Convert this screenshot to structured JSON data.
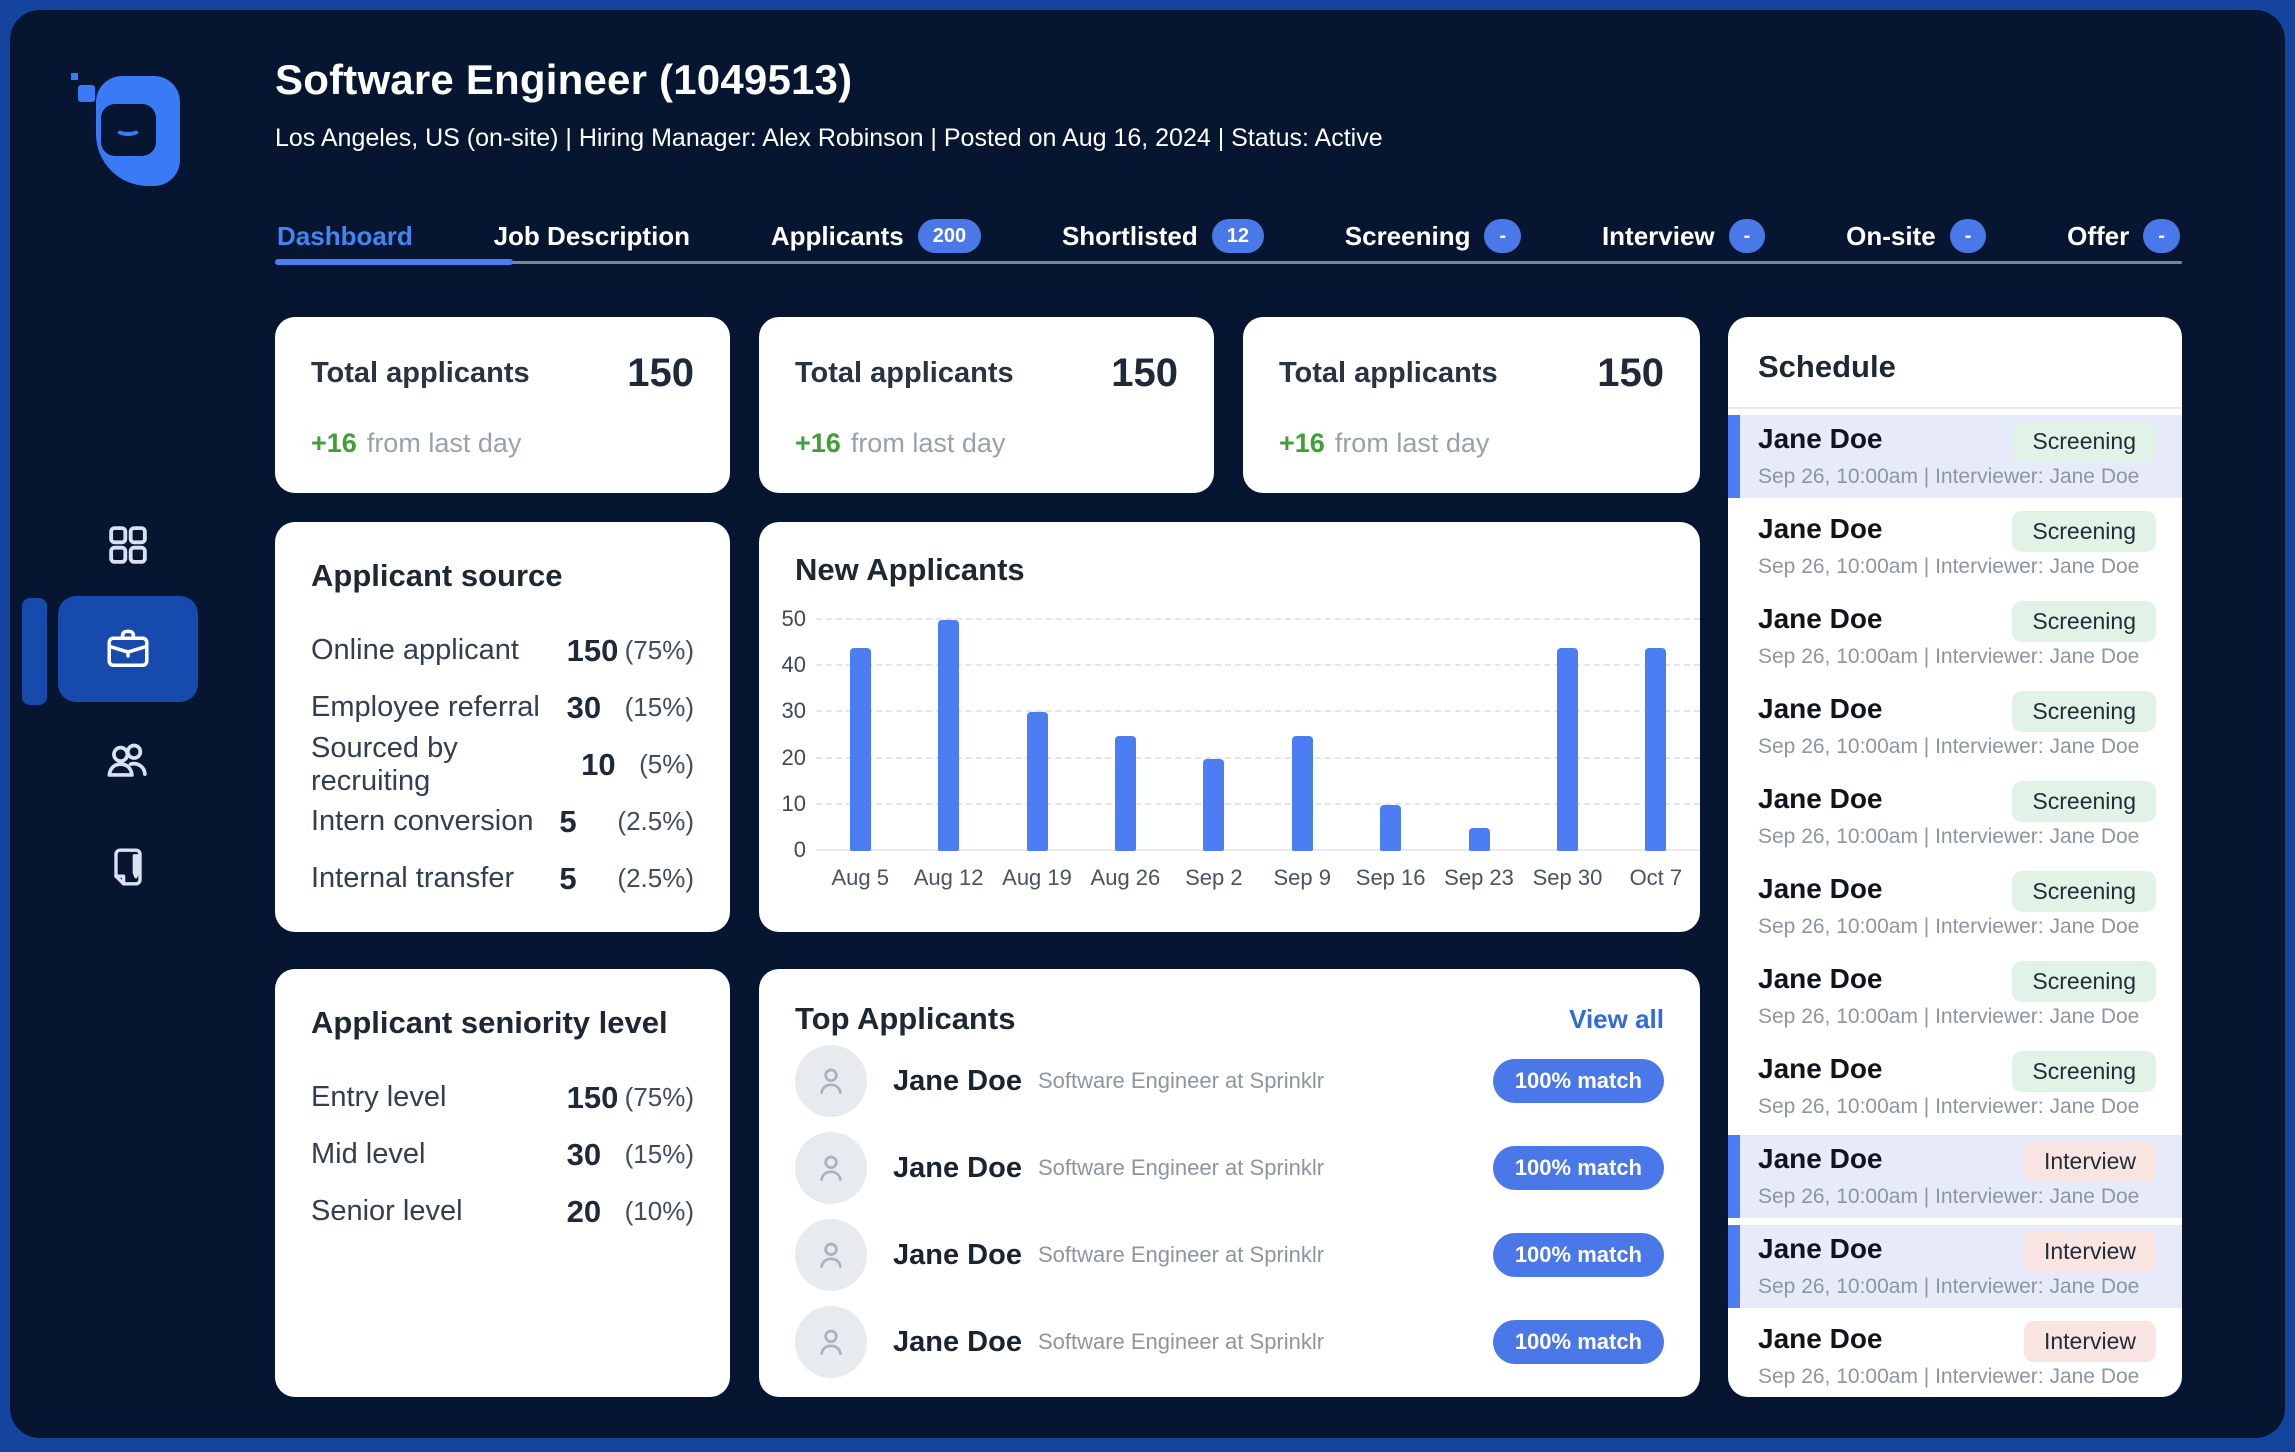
{
  "header": {
    "title": "Software Engineer (1049513)",
    "subtitle": "Los Angeles, US (on-site) | Hiring Manager: Alex Robinson | Posted on Aug 16, 2024 | Status: Active"
  },
  "tabs": [
    {
      "label": "Dashboard",
      "active": true
    },
    {
      "label": "Job Description"
    },
    {
      "label": "Applicants",
      "badge": "200"
    },
    {
      "label": "Shortlisted",
      "badge": "12"
    },
    {
      "label": "Screening",
      "badge": "-"
    },
    {
      "label": "Interview",
      "badge": "-"
    },
    {
      "label": "On-site",
      "badge": "-"
    },
    {
      "label": "Offer",
      "badge": "-"
    }
  ],
  "stats": [
    {
      "title": "Total applicants",
      "value": "150",
      "delta": "+16",
      "caption": "from last day"
    },
    {
      "title": "Total applicants",
      "value": "150",
      "delta": "+16",
      "caption": "from last day"
    },
    {
      "title": "Total applicants",
      "value": "150",
      "delta": "+16",
      "caption": "from last day"
    }
  ],
  "source": {
    "title": "Applicant source",
    "rows": [
      {
        "label": "Online applicant",
        "value": "150",
        "pct": "(75%)"
      },
      {
        "label": "Employee referral",
        "value": "30",
        "pct": "(15%)"
      },
      {
        "label": "Sourced by recruiting",
        "value": "10",
        "pct": "(5%)"
      },
      {
        "label": "Intern conversion",
        "value": "5",
        "pct": "(2.5%)"
      },
      {
        "label": "Internal transfer",
        "value": "5",
        "pct": "(2.5%)"
      }
    ]
  },
  "chart_data": {
    "type": "bar",
    "title": "New Applicants",
    "categories": [
      "Aug 5",
      "Aug 12",
      "Aug 19",
      "Aug 26",
      "Sep 2",
      "Sep 9",
      "Sep 16",
      "Sep 23",
      "Sep 30",
      "Oct 7"
    ],
    "values": [
      44,
      50,
      30,
      25,
      20,
      25,
      10,
      5,
      44,
      44
    ],
    "xlabel": "",
    "ylabel": "",
    "ylim": [
      0,
      50
    ],
    "yticks": [
      0,
      10,
      20,
      30,
      40,
      50
    ],
    "grid": "dashed-horizontal",
    "legend": "none",
    "bar_color": "#4d7df2"
  },
  "seniority": {
    "title": "Applicant seniority level",
    "rows": [
      {
        "label": "Entry level",
        "value": "150",
        "pct": "(75%)"
      },
      {
        "label": "Mid level",
        "value": "30",
        "pct": "(15%)"
      },
      {
        "label": "Senior level",
        "value": "20",
        "pct": "(10%)"
      }
    ]
  },
  "top_applicants": {
    "title": "Top Applicants",
    "view_all": "View all",
    "rows": [
      {
        "name": "Jane Doe",
        "role": "Software Engineer at Sprinklr",
        "match": "100% match"
      },
      {
        "name": "Jane Doe",
        "role": "Software Engineer at Sprinklr",
        "match": "100% match"
      },
      {
        "name": "Jane Doe",
        "role": "Software Engineer at Sprinklr",
        "match": "100% match"
      },
      {
        "name": "Jane Doe",
        "role": "Software Engineer at Sprinklr",
        "match": "100% match"
      }
    ]
  },
  "schedule": {
    "title": "Schedule",
    "items": [
      {
        "name": "Jane Doe",
        "stage": "Screening",
        "type": "screening",
        "detail": "Sep 26, 10:00am | Interviewer: Jane Doe",
        "highlighted": true
      },
      {
        "name": "Jane Doe",
        "stage": "Screening",
        "type": "screening",
        "detail": "Sep 26, 10:00am | Interviewer: Jane Doe",
        "highlighted": false
      },
      {
        "name": "Jane Doe",
        "stage": "Screening",
        "type": "screening",
        "detail": "Sep 26, 10:00am | Interviewer: Jane Doe",
        "highlighted": false
      },
      {
        "name": "Jane Doe",
        "stage": "Screening",
        "type": "screening",
        "detail": "Sep 26, 10:00am | Interviewer: Jane Doe",
        "highlighted": false
      },
      {
        "name": "Jane Doe",
        "stage": "Screening",
        "type": "screening",
        "detail": "Sep 26, 10:00am | Interviewer: Jane Doe",
        "highlighted": false
      },
      {
        "name": "Jane Doe",
        "stage": "Screening",
        "type": "screening",
        "detail": "Sep 26, 10:00am | Interviewer: Jane Doe",
        "highlighted": false
      },
      {
        "name": "Jane Doe",
        "stage": "Screening",
        "type": "screening",
        "detail": "Sep 26, 10:00am | Interviewer: Jane Doe",
        "highlighted": false
      },
      {
        "name": "Jane Doe",
        "stage": "Screening",
        "type": "screening",
        "detail": "Sep 26, 10:00am | Interviewer: Jane Doe",
        "highlighted": false
      },
      {
        "name": "Jane Doe",
        "stage": "Interview",
        "type": "interview",
        "detail": "Sep 26, 10:00am | Interviewer: Jane Doe",
        "highlighted": true
      },
      {
        "name": "Jane Doe",
        "stage": "Interview",
        "type": "interview",
        "detail": "Sep 26, 10:00am | Interviewer: Jane Doe",
        "highlighted": true
      },
      {
        "name": "Jane Doe",
        "stage": "Interview",
        "type": "interview",
        "detail": "Sep 26, 10:00am | Interviewer: Jane Doe",
        "highlighted": false
      }
    ]
  },
  "sidebar": {
    "items": [
      {
        "icon": "grid-icon",
        "active": false
      },
      {
        "icon": "briefcase-icon",
        "active": true
      },
      {
        "icon": "people-icon",
        "active": false
      },
      {
        "icon": "document-pen-icon",
        "active": false
      }
    ]
  },
  "colors": {
    "frame_blue": "#15449f",
    "panel_bg": "#061530",
    "active_nav": "#164aad",
    "logo_blue": "#3b7af5",
    "accent_blue": "#4d7df2",
    "badge_blue": "#4a78e8",
    "tab_active_text": "#4285f4",
    "delta_green": "#3fa037",
    "screening_badge_bg": "#e1f3e7",
    "interview_badge_bg": "#f8e5e1",
    "schedule_highlight_bg": "#e7ebf9"
  }
}
